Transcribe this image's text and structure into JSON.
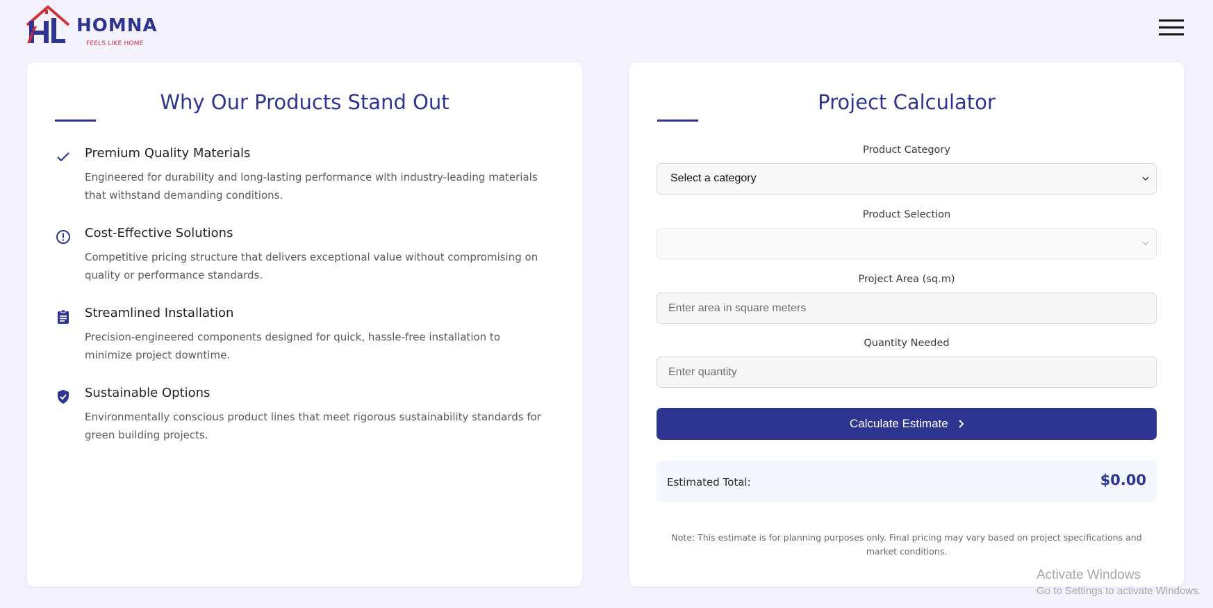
{
  "brand": {
    "name": "HOMNA",
    "tagline": "FEELS LIKE HOME",
    "primary_color": "#2d3591",
    "accent_color": "#d0303a"
  },
  "header": {
    "menu_icon": "hamburger-menu-icon"
  },
  "features": {
    "title": "Why Our Products Stand Out",
    "items": [
      {
        "icon": "checkmark-icon",
        "title": "Premium Quality Materials",
        "description": "Engineered for durability and long-lasting performance with industry-leading materials that withstand demanding conditions."
      },
      {
        "icon": "exclamation-circle-icon",
        "title": "Cost-Effective Solutions",
        "description": "Competitive pricing structure that delivers exceptional value without compromising on quality or performance standards."
      },
      {
        "icon": "clipboard-icon",
        "title": "Streamlined Installation",
        "description": "Precision-engineered components designed for quick, hassle-free installation to minimize project downtime."
      },
      {
        "icon": "shield-check-icon",
        "title": "Sustainable Options",
        "description": "Environmentally conscious product lines that meet rigorous sustainability standards for green building projects."
      }
    ]
  },
  "calculator": {
    "title": "Project Calculator",
    "category_label": "Product Category",
    "category_value": "Select a category",
    "product_label": "Product Selection",
    "product_value": "",
    "area_label": "Project Area (sq.m)",
    "area_placeholder": "Enter area in square meters",
    "quantity_label": "Quantity Needed",
    "quantity_placeholder": "Enter quantity",
    "button_label": "Calculate Estimate",
    "total_label": "Estimated Total:",
    "total_value": "$0.00",
    "note": "Note: This estimate is for planning purposes only. Final pricing may vary based on project specifications and market conditions."
  },
  "watermark": {
    "line1": "Activate Windows",
    "line2": "Go to Settings to activate Windows."
  }
}
